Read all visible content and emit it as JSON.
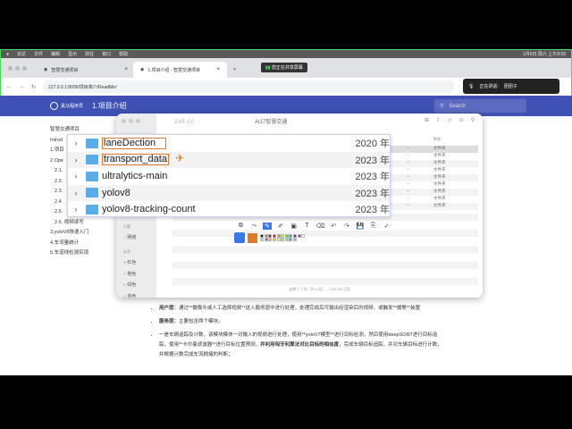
{
  "menubar": {
    "items": [
      "访达",
      "文件",
      "编辑",
      "显示",
      "前往",
      "窗口",
      "帮助"
    ],
    "clock": "1月6日 周六 上午8:56"
  },
  "tabs": [
    {
      "label": "智慧交通项目"
    },
    {
      "label": "1.项目介绍 - 智慧交通项目"
    }
  ],
  "share_banner": "您正在共享屏幕",
  "address": {
    "url": "127.0.0.1:8000/项目简介/ReadMe/"
  },
  "speaking": {
    "label": "正在讲话:",
    "name": "团团子"
  },
  "doc": {
    "logo": "黑马程序员",
    "title": "1.项目介绍",
    "search_placeholder": "Search"
  },
  "nav": [
    {
      "label": "智慧交通项目",
      "sub": false
    },
    {
      "label": "Introd",
      "sub": false
    },
    {
      "label": "1.项目",
      "sub": false
    },
    {
      "label": "2.Ope",
      "sub": false
    },
    {
      "label": "2.1.",
      "sub": true
    },
    {
      "label": "2.2.",
      "sub": true
    },
    {
      "label": "2.3.",
      "sub": true
    },
    {
      "label": "2.4.",
      "sub": true
    },
    {
      "label": "2.5.",
      "sub": true
    },
    {
      "label": "2.6. 视频读写",
      "sub": true
    },
    {
      "label": "3.yoloV8快速入门",
      "sub": false
    },
    {
      "label": "4.车流量统计",
      "sub": false
    },
    {
      "label": "5.车道线检测实现",
      "sub": false
    }
  ],
  "finder": {
    "title": "AI17智慧交通",
    "watermark": "zxit.cc",
    "col_size": "大小",
    "col_kind": "种类",
    "rows": [
      {
        "size": "--",
        "kind": "文件夹"
      },
      {
        "size": "--",
        "kind": "文件夹"
      },
      {
        "size": "--",
        "kind": "文件夹"
      },
      {
        "size": "--",
        "kind": "文件夹"
      },
      {
        "size": "--",
        "kind": "文件夹"
      },
      {
        "size": "--",
        "kind": "文件夹"
      },
      {
        "size": "--",
        "kind": "文件夹"
      },
      {
        "size": "--",
        "kind": "文件夹"
      },
      {
        "size": "--",
        "kind": "文件夹"
      }
    ],
    "side_location": "位置",
    "side_network": "网络",
    "side_tags": "标签",
    "tags": [
      {
        "label": "红色",
        "color": "#e8a0a8"
      },
      {
        "label": "橙色",
        "color": "#f0c080"
      },
      {
        "label": "绿色",
        "color": "#a8d8a0"
      },
      {
        "label": "蓝色",
        "color": "#a8c0e8"
      }
    ],
    "status": "选择了 1 项（共 9 项），7.63 GB 可用"
  },
  "zoom_folders": [
    {
      "name": "laneDection",
      "year": "2020 年",
      "boxed": true
    },
    {
      "name": "transport_data",
      "year": "2023 年",
      "boxed": true
    },
    {
      "name": "ultralytics-main",
      "year": "2023 年"
    },
    {
      "name": "yolov8",
      "year": "2023 年"
    },
    {
      "name": "yolov8-tracking-count",
      "year": "2023 年"
    }
  ],
  "anno": {
    "tools": [
      "⧉",
      "⤳",
      "✎",
      "✐",
      "▣",
      "T",
      "⌫",
      "↶",
      "↷",
      "💾",
      "⎘",
      "✓"
    ],
    "swatches": [
      "#000",
      "#888",
      "#800",
      "#c00",
      "#e07b2a",
      "#ee0",
      "#4c4",
      "#2a8",
      "#33a",
      "#838",
      "#fff",
      "#ccc",
      "#a66",
      "#e9a",
      "#ec0",
      "#ee8",
      "#ad4",
      "#8cc",
      "#68a",
      "#aad"
    ],
    "current_color": "#e07b2a"
  },
  "content": [
    {
      "bold": "用户层：",
      "text": "通过**摄像头或人工选择视频**送入服务层中进行处理，处理完成后可输出经渲染后的视频，或触发**报警**装置"
    },
    {
      "bold": "服务层：",
      "text": "主要包含两个模块。"
    },
    {
      "bold": "",
      "text": "一是车辆追踪及计数，该模块模块一对输入的视频进行处理，使用**yoloV7模型**进行目标检测，然后使用deepSORT进行目标追踪，使用**卡尔曼滤波器**进行目标位置预测，",
      "bold2": "并利用匈牙利算法对比目标的相似度",
      "text2": "，完成车辆目标追踪，并对车辆目标进行计数，并根据计数完成车流拥堵的判断；"
    }
  ]
}
